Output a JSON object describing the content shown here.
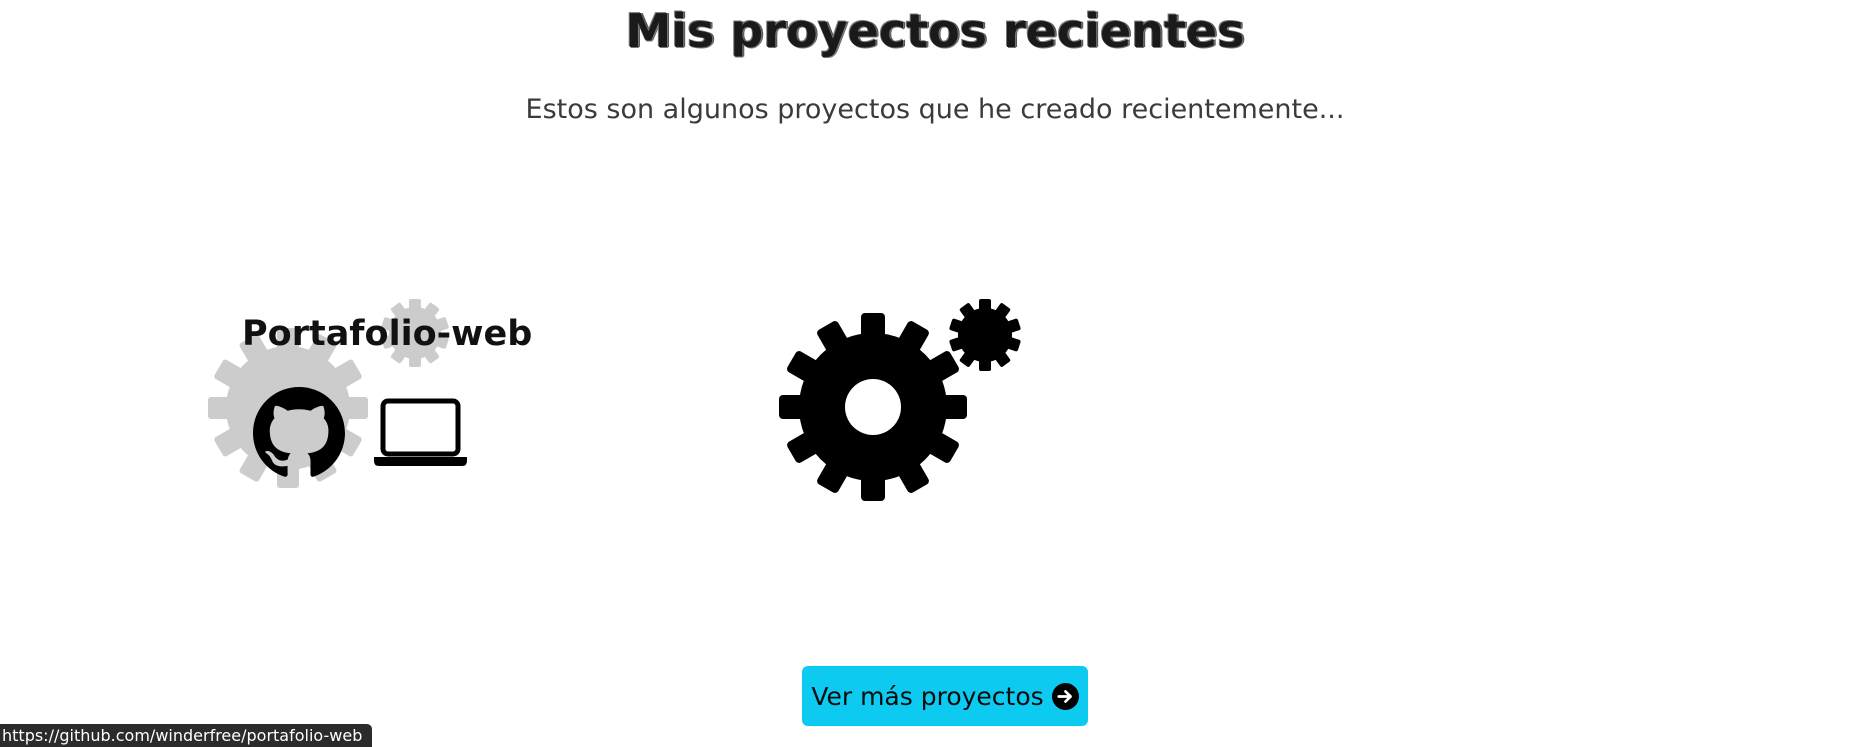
{
  "section": {
    "title": "Mis proyectos recientes",
    "subtitle": "Estos son algunos proyectos que he creado recientemente..."
  },
  "projects": [
    {
      "name": "Portafolio-web",
      "github_icon": "github-icon",
      "demo_icon": "laptop-icon",
      "background_icon": "gears-icon"
    }
  ],
  "placeholder": {
    "icon": "gears-icon"
  },
  "cta": {
    "label": "Ver más proyectos",
    "icon": "arrow-right-circle-icon",
    "color": "#0ccaf0"
  },
  "status_bar": {
    "url": "https://github.com/winderfree/portafolio-web"
  }
}
